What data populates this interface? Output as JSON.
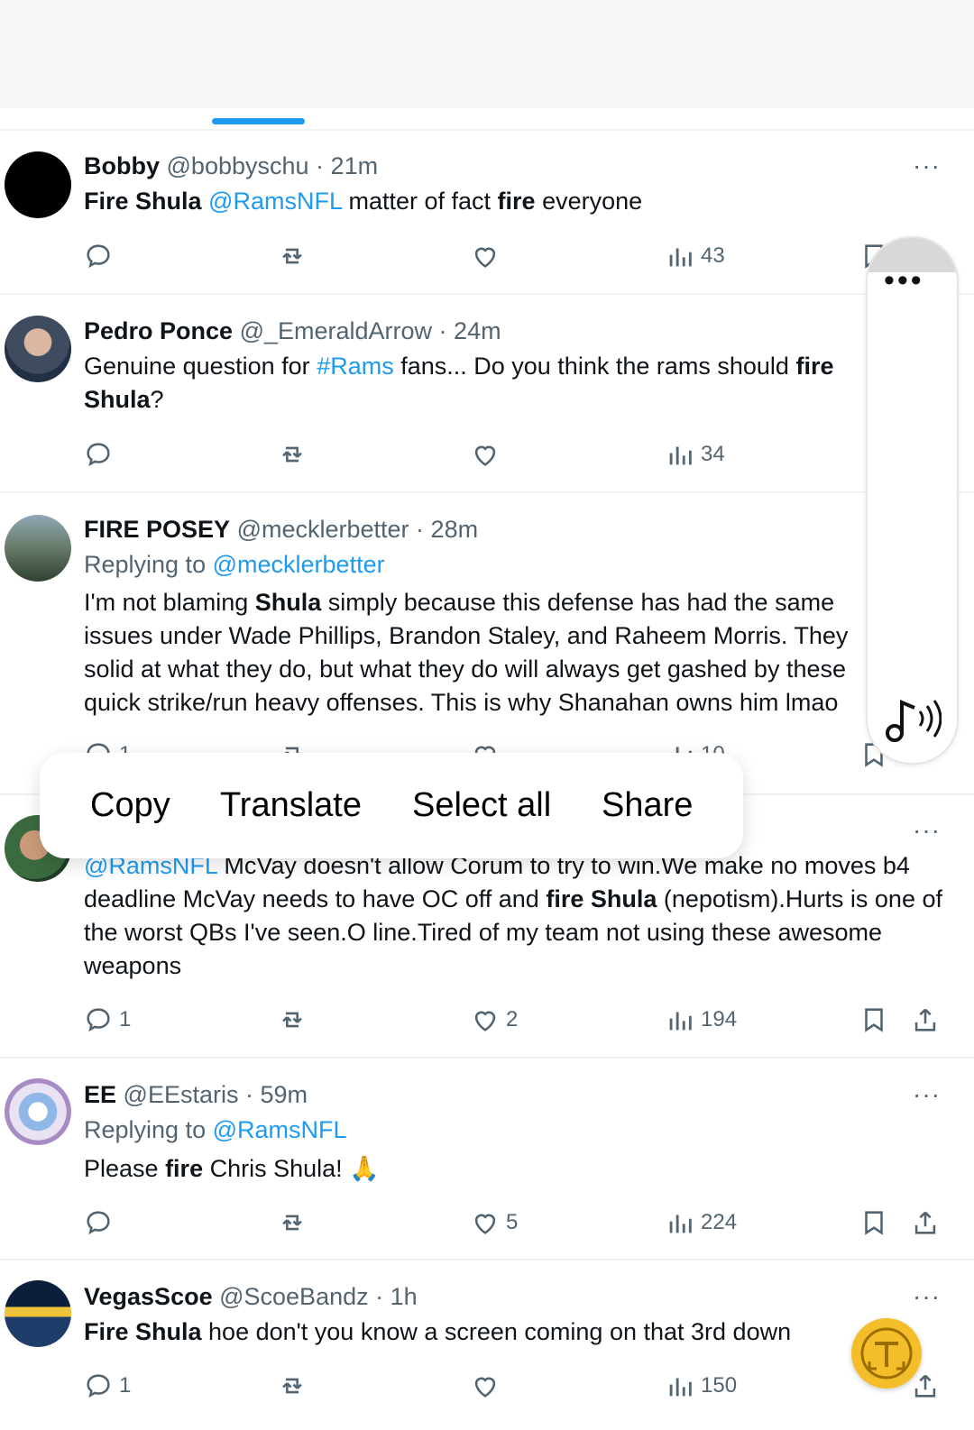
{
  "tweets": [
    {
      "name": "Bobby",
      "handle": "@bobbyschu",
      "time": "21m",
      "parts": [
        [
          "b",
          "Fire Shula"
        ],
        [
          "t",
          " "
        ],
        [
          "l",
          "@RamsNFL"
        ],
        [
          "t",
          " matter of fact "
        ],
        [
          "b",
          "fire"
        ],
        [
          "t",
          " everyone"
        ]
      ],
      "views": "43"
    },
    {
      "name": "Pedro Ponce",
      "handle": "@_EmeraldArrow",
      "time": "24m",
      "parts": [
        [
          "t",
          "Genuine question for "
        ],
        [
          "l",
          "#Rams"
        ],
        [
          "t",
          " fans... Do you think the rams should "
        ],
        [
          "b",
          "fire"
        ],
        [
          "t",
          " "
        ],
        [
          "b",
          "Shula"
        ],
        [
          "t",
          "?"
        ]
      ],
      "views": "34"
    },
    {
      "name": "FIRE POSEY",
      "handle": "@mecklerbetter",
      "time": "28m",
      "replying_label": "Replying to",
      "replying_to": "@mecklerbetter",
      "parts": [
        [
          "t",
          "I'm not blaming "
        ],
        [
          "b",
          "Shula"
        ],
        [
          "t",
          " simply because this defense has had the same issues under Wade Phillips, Brandon Staley, and Raheem Morris. They solid at what they do, but what they do will always get gashed by these quick strike/run heavy offenses. This is why Shanahan owns him lmao"
        ]
      ],
      "replies": "1",
      "views": "10"
    },
    {
      "parts": [
        [
          "l",
          "@RamsNFL"
        ],
        [
          "t",
          " McVay doesn't allow Corum to try to win.We make no moves b4 deadline McVay needs to have OC off and "
        ],
        [
          "b",
          "fire Shula"
        ],
        [
          "t",
          " (nepotism).Hurts is one of the worst QBs I've seen.O line.Tired of my team not using these awesome weapons"
        ]
      ],
      "replies": "1",
      "likes": "2",
      "views": "194"
    },
    {
      "name": "EE",
      "handle": "@EEstaris",
      "time": "59m",
      "replying_label": "Replying to",
      "replying_to": "@RamsNFL",
      "parts": [
        [
          "t",
          "Please "
        ],
        [
          "b",
          "fire"
        ],
        [
          "t",
          " Chris Shula! 🙏"
        ]
      ],
      "likes": "5",
      "views": "224"
    },
    {
      "name": "VegasScoe",
      "handle": "@ScoeBandz",
      "time": "1h",
      "parts": [
        [
          "b",
          "Fire Shula"
        ],
        [
          "t",
          " hoe don't you know a screen coming on that 3rd down"
        ]
      ],
      "replies": "1",
      "views": "150"
    }
  ],
  "context_menu": {
    "copy": "Copy",
    "translate": "Translate",
    "select_all": "Select all",
    "share": "Share"
  },
  "side_widget": {
    "dots": "•••"
  },
  "more_glyph": "···",
  "colors": {
    "accent": "#1d9bf0",
    "muted": "#536471",
    "text": "#0f1419",
    "bubble": "#f4bd2a"
  }
}
